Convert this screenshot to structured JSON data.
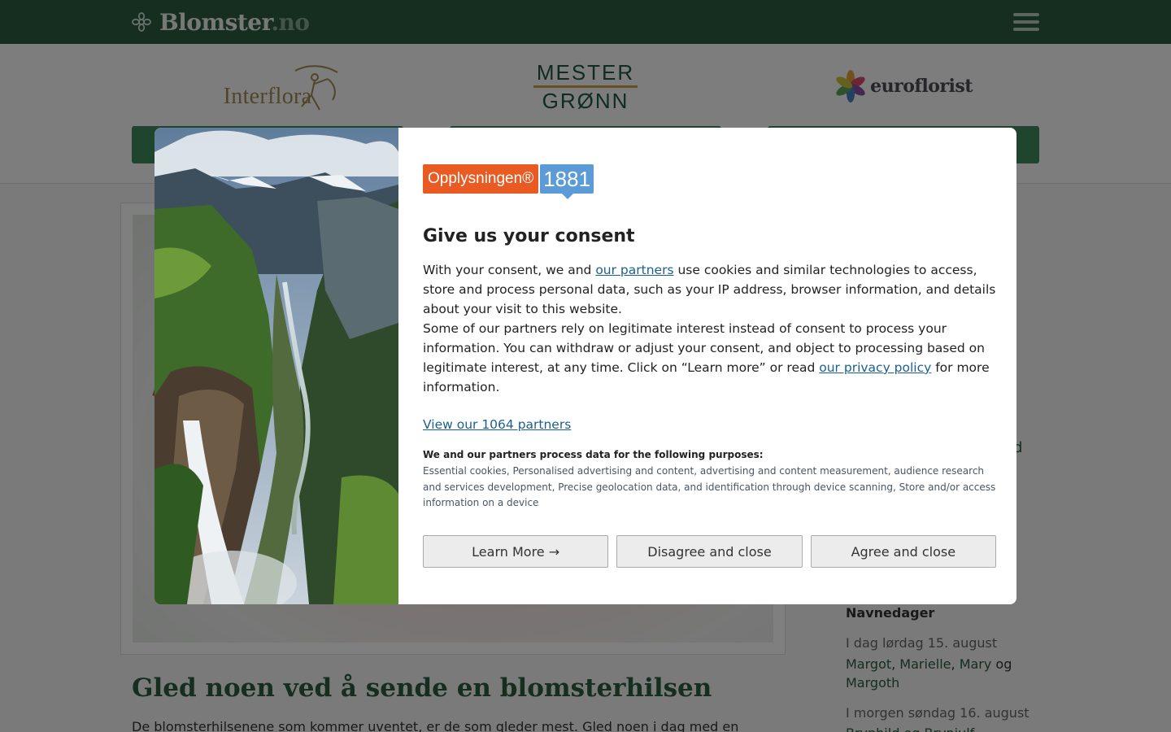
{
  "site": {
    "brand_name": "Blomster",
    "brand_tld": ".no"
  },
  "partners": [
    {
      "name": "Interflora"
    },
    {
      "name_line1": "MESTER",
      "name_line2": "GRØNN"
    },
    {
      "name": "euroflorist"
    }
  ],
  "article": {
    "title": "Gled noen ved å sende en blomsterhilsen",
    "lead": "De blomsterhilsenene som kommer uventet, er de som gleder mest. Gled noen i dag med en"
  },
  "sidebar": {
    "fragment": "d",
    "namedays_title": "Navnedager",
    "today_label": "I dag lørdag 15. august",
    "today_names": [
      "Margot",
      "Marielle",
      "Mary",
      "Margoth"
    ],
    "names_sep": ", ",
    "names_and": " og ",
    "tomorrow_label": "I morgen søndag 16. august",
    "tomorrow_names": "Brynhild og Brynjulf"
  },
  "consent": {
    "logo_left": "Opplysningen®",
    "logo_right": "1881",
    "title": "Give us your consent",
    "p1_before": "With your consent, we and ",
    "p1_link": "our partners",
    "p1_after": " use cookies and similar technologies to access, store and process personal data, such as your IP address, browser information, and details about your visit to this website.",
    "p2_before": "Some of our partners rely on legitimate interest instead of consent to process your information. You can withdraw or adjust your consent, and object to processing based on legitimate interest, at any time. Click on “Learn more” or read ",
    "p2_link": "our privacy policy",
    "p2_after": " for more information.",
    "partners_link": "View our 1064 partners",
    "purposes_title": "We and our partners process data for the following purposes:",
    "purposes_text": "Essential cookies, Personalised advertising and content, advertising and content measurement, audience research and services development, Precise geolocation data, and identification through device scanning, Store and/or access information on a device",
    "buttons": {
      "learn_more": "Learn More →",
      "disagree": "Disagree and close",
      "agree": "Agree and close"
    }
  },
  "colors": {
    "header_green": "#2a5c40",
    "button_green": "#3e8a5c",
    "link_blue": "#1a5f93",
    "logo_orange": "#ea5b23",
    "logo_blue": "#5b9bd8"
  },
  "icons": [
    "flower-logo-icon",
    "menu-icon"
  ]
}
